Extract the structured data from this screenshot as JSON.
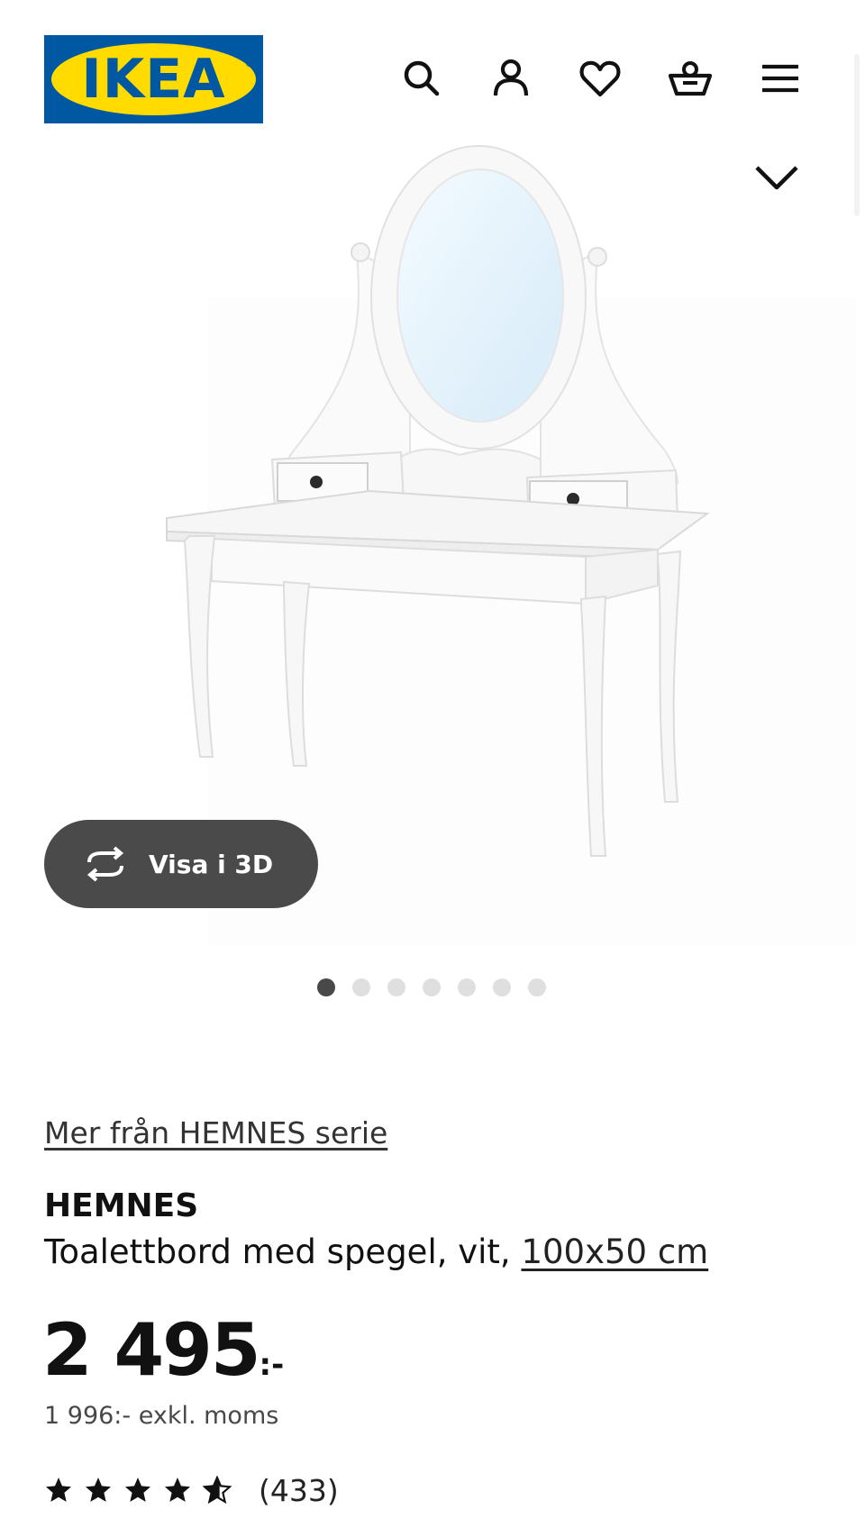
{
  "header": {
    "logo_text": "IKEA",
    "logo_reg": "®",
    "icons": [
      "search-icon",
      "account-icon",
      "heart-icon",
      "basket-icon",
      "menu-icon"
    ],
    "colors": {
      "brand_blue": "#0058a3",
      "brand_yellow": "#ffdb00"
    }
  },
  "gallery": {
    "view_3d_label": "Visa i 3D",
    "image_count": 7,
    "active_index": 0
  },
  "product": {
    "series_link": "Mer från HEMNES serie",
    "name": "HEMNES",
    "description": "Toalettbord med spegel, vit, ",
    "size_link": "100x50 cm",
    "price_main": "2 495",
    "price_suffix": ":-",
    "price_excl_vat": "1 996:- exkl. moms",
    "rating_stars": 4.5,
    "review_count": "(433)"
  }
}
